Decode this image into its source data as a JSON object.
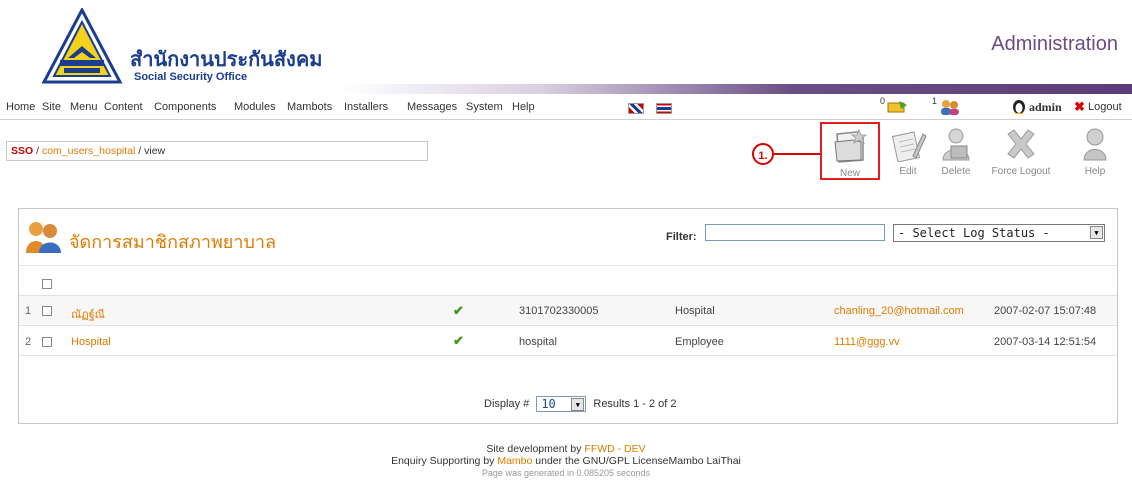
{
  "header": {
    "logo_thai": "สำนักงานประกันสังคม",
    "logo_english": "Social Security Office",
    "admin_title": "Administration"
  },
  "menu": {
    "items": [
      "Home",
      "Site",
      "Menu",
      "Content",
      "Components",
      "Modules",
      "Mambots",
      "Installers",
      "Messages",
      "System",
      "Help"
    ],
    "msg_count": "0",
    "user_count": "1",
    "user": "admin",
    "logout": "Logout"
  },
  "breadcrumb": {
    "root": "SSO",
    "component": "com_users_hospital",
    "sep1": " / ",
    "sep2": " / ",
    "current": "view"
  },
  "toolbar": {
    "marker": "1.",
    "buttons": [
      "New",
      "Edit",
      "Delete",
      "Force Logout",
      "Help"
    ]
  },
  "panel": {
    "title": "จัดการสมาชิกสภาพยาบาล",
    "filter_label": "Filter:",
    "filter_value": "",
    "log_status": "- Select Log Status -"
  },
  "table": {
    "rows": [
      {
        "num": "1",
        "name": "ณัฏฐ์ณี",
        "id": "3101702330005",
        "type": "Hospital",
        "email": "chanling_20@hotmail.com",
        "date": "2007-02-07 15:07:48"
      },
      {
        "num": "2",
        "name": "Hospital",
        "id": "hospital",
        "type": "Employee",
        "email": "1111@ggg.vv",
        "date": "2007-03-14 12:51:54"
      }
    ]
  },
  "pager": {
    "display_label": "Display #",
    "display_value": "10",
    "results": "Results 1 - 2 of 2"
  },
  "footer": {
    "line1_pre": "Site development by ",
    "line1_link": "FFWD - DEV",
    "line2_pre": "Enquiry Supporting by ",
    "line2_link": "Mambo",
    "line2_post": " under the GNU/GPL LicenseMambo LaiThai",
    "line3": "Page was generated in 0.085205 seconds"
  },
  "colors": {
    "accent_orange": "#e07b00",
    "brand_purple": "#6b4a86",
    "marker_red": "#d00000"
  }
}
